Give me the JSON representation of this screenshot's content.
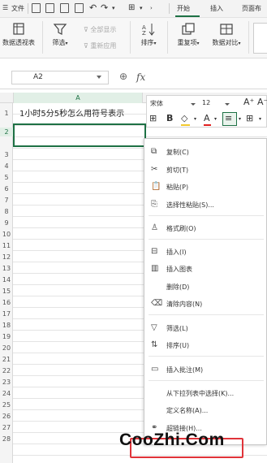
{
  "menubar": {
    "file_label": "文件",
    "tabs": [
      "开始",
      "插入",
      "页面布"
    ]
  },
  "ribbon": {
    "pivot_label": "数据透视表",
    "filter_label": "筛选",
    "show_all_label": "全部显示",
    "reapply_label": "重新应用",
    "sort_label": "排序",
    "duplicate_label": "重复项",
    "compare_label": "数据对比"
  },
  "formula_bar": {
    "cell_ref": "A2",
    "fx": "fx"
  },
  "sheet": {
    "column_a": "A",
    "rows": [
      "1",
      "2",
      "3",
      "4",
      "5",
      "6",
      "7",
      "8",
      "9",
      "10",
      "11",
      "12",
      "13",
      "14",
      "15",
      "16",
      "17",
      "18",
      "19",
      "20",
      "21",
      "22",
      "23",
      "24",
      "25",
      "26",
      "27",
      "28"
    ],
    "cell_a1": "1小时5分5秒怎么用符号表示"
  },
  "mini_toolbar": {
    "font_name": "宋体",
    "font_size": "12",
    "bold": "B"
  },
  "context_menu": {
    "items": [
      {
        "label": "复制(C)",
        "icon": "copy-icon"
      },
      {
        "label": "剪切(T)",
        "icon": "cut-icon"
      },
      {
        "label": "粘贴(P)",
        "icon": "paste-icon"
      },
      {
        "label": "选择性粘贴(S)...",
        "icon": "paste-special-icon"
      },
      {
        "label": "格式刷(O)",
        "icon": "format-painter-icon"
      },
      {
        "label": "插入(I)",
        "icon": "insert-icon"
      },
      {
        "label": "插入图表",
        "icon": "chart-icon"
      },
      {
        "label": "删除(D)",
        "icon": ""
      },
      {
        "label": "清除内容(N)",
        "icon": "clear-icon"
      },
      {
        "label": "筛选(L)",
        "icon": "filter-icon"
      },
      {
        "label": "排序(U)",
        "icon": "sort-icon"
      },
      {
        "label": "插入批注(M)",
        "icon": "comment-icon"
      },
      {
        "label": "从下拉列表中选择(K)...",
        "icon": ""
      },
      {
        "label": "定义名称(A)...",
        "icon": ""
      },
      {
        "label": "超链接(H)...",
        "icon": "link-icon"
      }
    ]
  },
  "watermark": {
    "text": "CooZhi.Com"
  },
  "colors": {
    "accent": "#1e7145",
    "watermark_box": "#e0343a"
  }
}
